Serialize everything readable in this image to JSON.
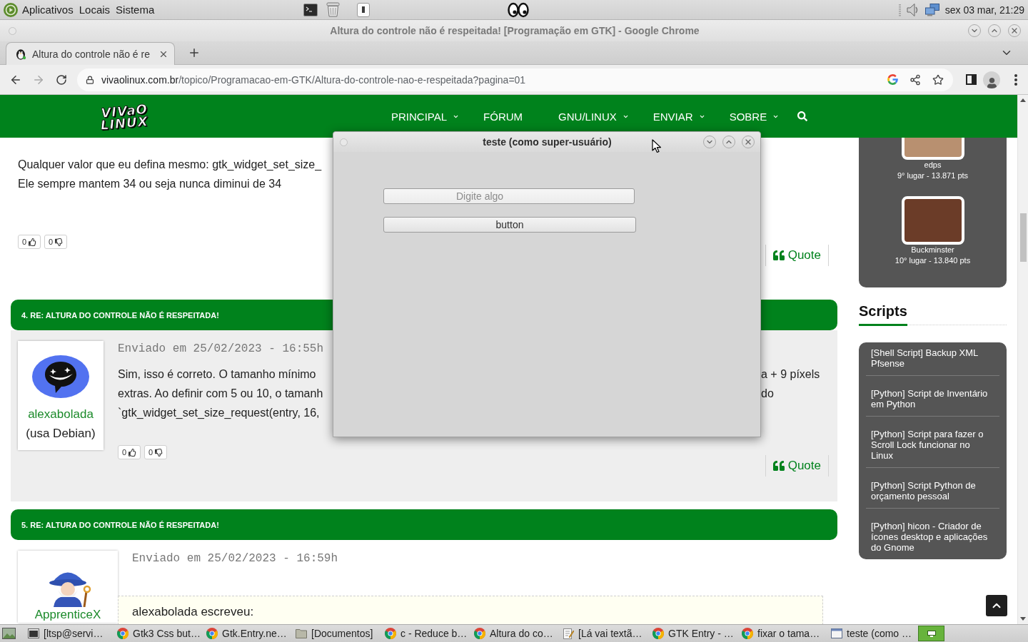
{
  "top_panel": {
    "menus": [
      "Aplicativos",
      "Locais",
      "Sistema"
    ],
    "clock": "sex 03 mar, 21:29"
  },
  "browser": {
    "title": "Altura do controle não é respeitada! [Programação em GTK] - Google Chrome",
    "tabs": [
      {
        "label": "Altura do controle não é re",
        "selected": true
      }
    ],
    "forward": {
      "disabled": true
    },
    "address": {
      "host": "vivaolinux.com.br",
      "path": "/topico/Programacao-em-GTK/Altura-do-controle-nao-e-respeitada?pagina=01"
    }
  },
  "site": {
    "logo": [
      "VIVaO",
      "LINUX"
    ],
    "nav": [
      {
        "label": "PRINCIPAL",
        "dropdown": true
      },
      {
        "label": "FÓRUM",
        "dropdown": false
      },
      {
        "label": "GNU/LINUX",
        "dropdown": true
      },
      {
        "label": "ENVIAR",
        "dropdown": true
      },
      {
        "label": "SOBRE",
        "dropdown": true
      }
    ]
  },
  "previous_post": {
    "lines": [
      {
        "left": "Qualquer valor que eu defina mesmo: gtk_widget_set_size_"
      },
      {
        "left": "Ele sempre mantem 34 ou seja nunca diminui de 34"
      }
    ],
    "votes": {
      "up": "0",
      "down": "0"
    },
    "quote_button": "Quote"
  },
  "posts": [
    {
      "title": "4. RE: ALTURA DO CONTROLE NÃO É RESPEITADA!",
      "author": "alexabolada",
      "distro": "(usa Debian)",
      "date": "Enviado em 25/02/2023 - 16:55h",
      "lines": [
        {
          "left": "Sim, isso é correto. O tamanho mínimo",
          "right": "a + 9 píxels"
        },
        {
          "left": "extras. Ao definir com 5 ou 10, o tamanh",
          "right": "do"
        },
        {
          "left": "`gtk_widget_set_size_request(entry, 16,"
        }
      ],
      "votes": {
        "up": "0",
        "down": "0"
      },
      "quote_button": "Quote"
    },
    {
      "title": "5. RE: ALTURA DO CONTROLE NÃO É RESPEITADA!",
      "author": "ApprenticeX",
      "date": "Enviado em 25/02/2023 - 16:59h",
      "quote": {
        "attribution": "alexabolada escreveu:"
      }
    }
  ],
  "sidebar": {
    "ranking": [
      {
        "name": "edps",
        "rank": "9° lugar - 13.871 pts"
      },
      {
        "name": "Buckminster",
        "rank": "10° lugar - 13.840 pts"
      }
    ],
    "scripts": {
      "title": "Scripts",
      "items": [
        "[Shell Script] Backup XML Pfsense",
        "[Python] Script de Inventário em Python",
        "[Python] Script para fazer o Scroll Lock funcionar no Linux",
        "[Python] Script Python de orçamento pessoal",
        "[Python] hicon - Criador de ícones desktop e aplicações do Gnome"
      ]
    }
  },
  "dialog": {
    "title": "teste (como super-usuário)",
    "entry": {
      "placeholder": "Digite algo"
    },
    "button": "button"
  },
  "taskbar": {
    "items": [
      {
        "kind": "terminal",
        "label": "[ltsp@servi…"
      },
      {
        "kind": "browser",
        "label": "Gtk3 Css but…"
      },
      {
        "kind": "browser",
        "label": "Gtk.Entry.ne…"
      },
      {
        "kind": "folder",
        "label": "[Documentos]"
      },
      {
        "kind": "browser",
        "label": "c - Reduce b…"
      },
      {
        "kind": "browser",
        "label": "Altura do co…"
      },
      {
        "kind": "editor",
        "label": "[Lá vai textã…"
      },
      {
        "kind": "browser",
        "label": "GTK Entry - …"
      },
      {
        "kind": "browser",
        "label": "fixar o tama…"
      },
      {
        "kind": "window",
        "label": "teste (como …"
      }
    ]
  }
}
